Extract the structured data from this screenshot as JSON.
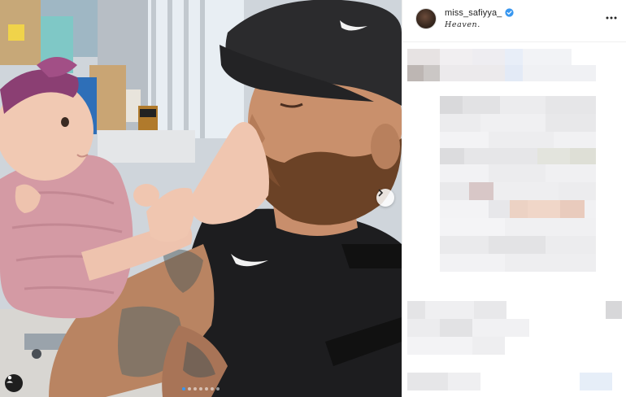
{
  "post": {
    "username": "miss_safiyya_",
    "location": "Heaven.",
    "verified_color": "#3897f0"
  },
  "controls": {
    "next_icon": "chevron-right-icon",
    "more_icon": "more-options-icon",
    "tag_icon": "user-tag-icon"
  },
  "carousel": {
    "total": 7,
    "active": 1
  },
  "colors": {
    "accent": "#3897f0",
    "text": "#262626",
    "divider": "#efefef"
  }
}
